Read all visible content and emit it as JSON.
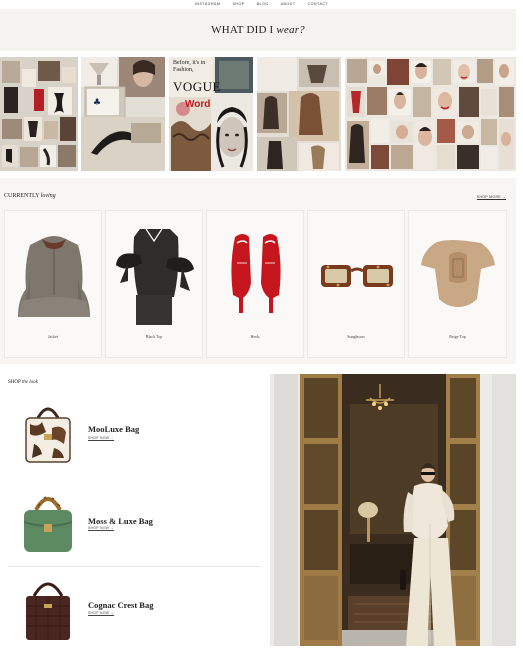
{
  "nav": {
    "items": [
      "INSTAGRAM",
      "SHOP",
      "BLOG",
      "ABOUT",
      "CONTACT"
    ]
  },
  "hero": {
    "title_main": "WHAT DID I ",
    "title_em": "wear?"
  },
  "collage": {
    "vogue_text": "VOGUE",
    "before_text": "Before, it's in Fashion,",
    "word_text": "Word"
  },
  "loving": {
    "title_main": "CURRENTLY ",
    "title_em": "loving",
    "shop_more": "SHOP MORE →",
    "products": [
      {
        "caption": "Jacket",
        "icon": "jacket"
      },
      {
        "caption": "Black Top",
        "icon": "bow-top"
      },
      {
        "caption": "Heels",
        "icon": "red-heels"
      },
      {
        "caption": "Sunglasses",
        "icon": "sunglasses"
      },
      {
        "caption": "Beige Top",
        "icon": "beige-top"
      }
    ]
  },
  "shop_look": {
    "title_main": "SHOP ",
    "title_em": "the look",
    "bags": [
      {
        "name": "MooLuxe Bag",
        "shop": "SHOP NOW →",
        "icon": "cow-print-bag"
      },
      {
        "name": "Moss & Luxe Bag",
        "shop": "SHOP NOW →",
        "icon": "green-bamboo-bag"
      },
      {
        "name": "Cognac Crest Bag",
        "shop": "SHOP NOW →",
        "icon": "croc-bag"
      }
    ]
  },
  "colors": {
    "hero_bg": "#f5f3f0",
    "accent_red": "#c4161c",
    "suit": "#efe8da"
  }
}
